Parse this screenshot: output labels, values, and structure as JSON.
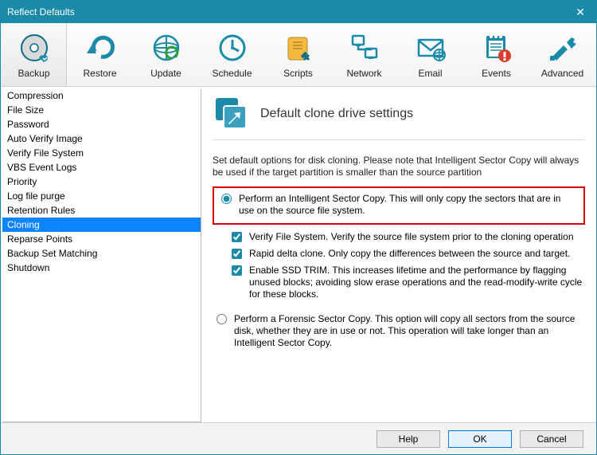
{
  "window": {
    "title": "Reflect Defaults"
  },
  "toolbar": {
    "items": [
      {
        "label": "Backup",
        "icon": "backup-icon"
      },
      {
        "label": "Restore",
        "icon": "restore-icon"
      },
      {
        "label": "Update",
        "icon": "update-icon"
      },
      {
        "label": "Schedule",
        "icon": "schedule-icon"
      },
      {
        "label": "Scripts",
        "icon": "scripts-icon"
      },
      {
        "label": "Network",
        "icon": "network-icon"
      },
      {
        "label": "Email",
        "icon": "email-icon"
      },
      {
        "label": "Events",
        "icon": "events-icon"
      },
      {
        "label": "Advanced",
        "icon": "advanced-icon"
      }
    ],
    "active_index": 0
  },
  "sidebar": {
    "items": [
      "Compression",
      "File Size",
      "Password",
      "Auto Verify Image",
      "Verify File System",
      "VBS Event Logs",
      "Priority",
      "Log file purge",
      "Retention Rules",
      "Cloning",
      "Reparse Points",
      "Backup Set Matching",
      "Shutdown"
    ],
    "selected_index": 9
  },
  "page": {
    "title": "Default clone drive settings",
    "description": "Set default options for disk cloning.  Please note that Intelligent Sector Copy will always be used if the target partition is smaller than the source partition",
    "option1": {
      "label": "Perform an Intelligent Sector Copy.  This will only copy the sectors that are in use on the source file system.",
      "checks": [
        {
          "label": "Verify File System.  Verify the source file system prior to the cloning operation",
          "checked": true
        },
        {
          "label": "Rapid delta clone.  Only copy the differences between the source and target.",
          "checked": true
        },
        {
          "label": "Enable SSD TRIM. This increases lifetime and the performance by flagging unused blocks; avoiding slow erase operations and the read-modify-write cycle for these blocks.",
          "checked": true
        }
      ]
    },
    "option2": {
      "label": "Perform a Forensic Sector Copy. This option will copy all sectors from the source disk, whether they are in use or not.  This operation will take longer than an Intelligent Sector Copy."
    },
    "selected_option": 1
  },
  "footer": {
    "help": "Help",
    "ok": "OK",
    "cancel": "Cancel"
  }
}
